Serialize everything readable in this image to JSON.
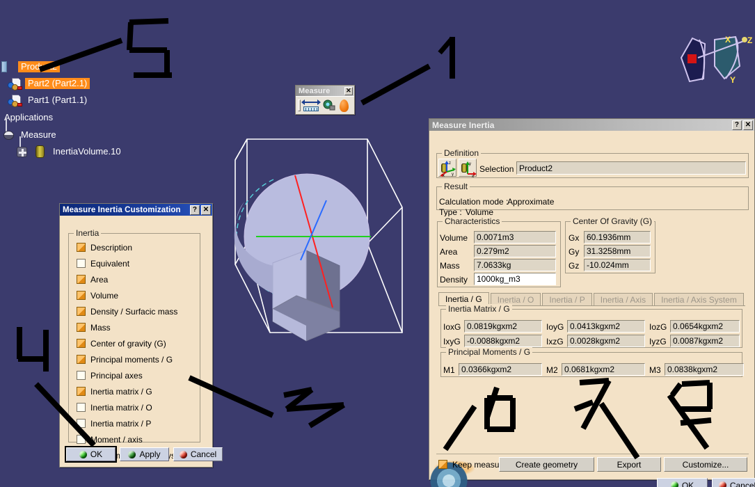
{
  "app": {
    "background_color": "#3b3b6d"
  },
  "spec_tree": {
    "items": [
      {
        "label": "Product2",
        "icon": "product-icon",
        "selected": true
      },
      {
        "label": "Part2 (Part2.1)",
        "icon": "part-icon",
        "selected": true
      },
      {
        "label": "Part1 (Part1.1)",
        "icon": "part-icon",
        "selected": false
      },
      {
        "label": "Applications",
        "icon": "applications-node",
        "selected": false
      },
      {
        "label": "Measure",
        "icon": "measure-node-icon",
        "selected": false
      },
      {
        "label": "InertiaVolume.10",
        "icon": "inertia-volume-icon",
        "selected": false
      }
    ]
  },
  "measure_toolbar": {
    "title": "Measure",
    "close_label": "✕",
    "tools": [
      {
        "name": "measure-between-icon",
        "tooltip": "Measure Between"
      },
      {
        "name": "measure-item-icon",
        "tooltip": "Measure Item"
      },
      {
        "name": "measure-inertia-icon",
        "tooltip": "Measure Inertia"
      }
    ]
  },
  "compass": {
    "x_label": "X",
    "y_label": "Y",
    "z_label": "Z"
  },
  "measure_inertia": {
    "title": "Measure Inertia",
    "help_label": "?",
    "close_label": "✕",
    "definition": {
      "legend": "Definition",
      "selection_label": "Selection :",
      "selection_value": "Product2",
      "axis_button_1": "main-axis-system-icon",
      "axis_button_2": "local-axis-system-icon"
    },
    "result": {
      "legend": "Result",
      "calculation_mode_label": "Calculation mode :",
      "calculation_mode_value": "Approximate",
      "type_label": "Type :",
      "type_value": "Volume"
    },
    "characteristics": {
      "legend": "Characteristics",
      "rows": [
        {
          "label": "Volume",
          "value": "0.0071m3",
          "editable": false
        },
        {
          "label": "Area",
          "value": "0.279m2",
          "editable": false
        },
        {
          "label": "Mass",
          "value": "7.0633kg",
          "editable": false
        },
        {
          "label": "Density",
          "value": "1000kg_m3",
          "editable": true
        }
      ]
    },
    "center_of_gravity": {
      "legend": "Center Of Gravity (G)",
      "rows": [
        {
          "label": "Gx",
          "value": "60.1936mm"
        },
        {
          "label": "Gy",
          "value": "31.3258mm"
        },
        {
          "label": "Gz",
          "value": "-10.024mm"
        }
      ]
    },
    "tabs": [
      {
        "label": "Inertia / G",
        "active": true
      },
      {
        "label": "Inertia / O",
        "active": false
      },
      {
        "label": "Inertia / P",
        "active": false
      },
      {
        "label": "Inertia / Axis",
        "active": false
      },
      {
        "label": "Inertia / Axis System",
        "active": false
      }
    ],
    "inertia_matrix": {
      "legend": "Inertia Matrix / G",
      "cells": [
        {
          "label": "IoxG",
          "value": "0.0819kgxm2"
        },
        {
          "label": "IoyG",
          "value": "0.0413kgxm2"
        },
        {
          "label": "IozG",
          "value": "0.0654kgxm2"
        },
        {
          "label": "IxyG",
          "value": "-0.0088kgxm2"
        },
        {
          "label": "IxzG",
          "value": "0.0028kgxm2"
        },
        {
          "label": "IyzG",
          "value": "0.0087kgxm2"
        }
      ]
    },
    "principal_moments": {
      "legend": "Principal Moments / G",
      "cells": [
        {
          "label": "M1",
          "value": "0.0366kgxm2"
        },
        {
          "label": "M2",
          "value": "0.0681kgxm2"
        },
        {
          "label": "M3",
          "value": "0.0838kgxm2"
        }
      ]
    },
    "footer": {
      "keep_measure_label": "Keep measure",
      "keep_measure_checked": true,
      "create_geometry_label": "Create geometry",
      "export_label": "Export",
      "customize_label": "Customize...",
      "ok_label": "OK",
      "cancel_label": "Cancel"
    }
  },
  "customization": {
    "title": "Measure Inertia Customization",
    "help_label": "?",
    "close_label": "✕",
    "group_legend": "Inertia",
    "options": [
      {
        "label": "Description",
        "checked": true
      },
      {
        "label": "Equivalent",
        "checked": false
      },
      {
        "label": "Area",
        "checked": true
      },
      {
        "label": "Volume",
        "checked": true
      },
      {
        "label": "Density / Surfacic mass",
        "checked": true
      },
      {
        "label": "Mass",
        "checked": true
      },
      {
        "label": "Center of gravity (G)",
        "checked": true
      },
      {
        "label": "Principal moments / G",
        "checked": true
      },
      {
        "label": "Principal axes",
        "checked": false
      },
      {
        "label": "Inertia matrix / G",
        "checked": true
      },
      {
        "label": "Inertia matrix / O",
        "checked": false
      },
      {
        "label": "Inertia matrix / P",
        "checked": false
      },
      {
        "label": "Moment / axis",
        "checked": false
      },
      {
        "label": "Inertia matrix / axis system",
        "checked": false
      }
    ],
    "buttons": {
      "ok_label": "OK",
      "apply_label": "Apply",
      "cancel_label": "Cancel"
    }
  },
  "annotations": [
    {
      "name": "annotation-1",
      "text": "1"
    },
    {
      "name": "annotation-2",
      "text": "2"
    },
    {
      "name": "annotation-3",
      "text": "3"
    },
    {
      "name": "annotation-4",
      "text": "4"
    },
    {
      "name": "annotation-5",
      "text": "5"
    },
    {
      "name": "annotation-6",
      "text": "6"
    },
    {
      "name": "annotation-7",
      "text": "7"
    }
  ],
  "model": {
    "description": "sphere-with-hex-prism",
    "axis_colors": {
      "principal_1": "#ff2020",
      "principal_2": "#1fd11f",
      "principal_3": "#2a6bff"
    },
    "bbox_color": "#ffffff"
  }
}
